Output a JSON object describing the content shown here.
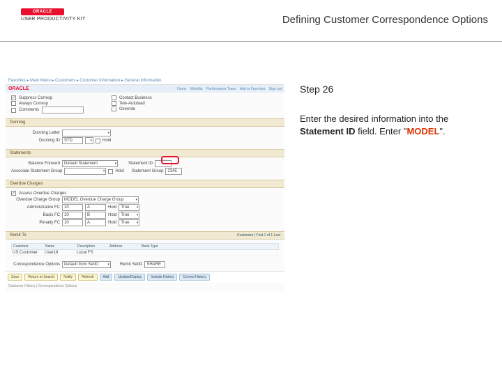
{
  "header": {
    "logo_text": "ORACLE",
    "upk_text": "USER PRODUCTIVITY KIT",
    "page_title": "Defining Customer Correspondence Options"
  },
  "screenshot": {
    "breadcrumbs": "Favorites ▸ Main Menu ▸ Customers ▸ Customer Information ▸ General Information",
    "brand": "ORACLE",
    "toplinks": [
      "Home",
      "Worklist",
      "Performance Trace",
      "Add to Favorites",
      "Sign out"
    ],
    "checks": {
      "suppress_corresp": "Suppress Corresp",
      "always_corresp": "Always Corresp",
      "comments": "Comments",
      "contact_business": "Contact Business",
      "tele_autoload": "Tele-Autoload",
      "override": "Override"
    },
    "dunning": {
      "heading": "Dunning",
      "dunning_letter_lbl": "Dunning Letter",
      "dunning_letter_val": "",
      "dunning_id_lbl": "Dunning ID",
      "dunning_id_val": "STD",
      "hold_lbl": "Hold"
    },
    "statements": {
      "heading": "Statements",
      "balance_frwd_lbl": "Balance Forward",
      "balance_frwd_val": "Default Statement",
      "statement_id_lbl": "Statement ID",
      "statement_id_val": "",
      "assoc_lbl": "Associate Statement Group",
      "assoc_val": "",
      "hold_lbl": "Hold",
      "statement_grp_lbl": "Statement Group",
      "statement_grp_val": "2345"
    },
    "overdue": {
      "heading": "Overdue Charges",
      "assess_lbl": "Assess Overdue Charges",
      "ovgrp_lbl": "Overdue Charge Group",
      "ovgrp_val": "MODEL Overdue Charge Group",
      "rows": [
        {
          "label": "Administrative FC",
          "v1": "10",
          "v2": "A",
          "v3": "Hold",
          "v4": "True"
        },
        {
          "label": "Basic FC",
          "v1": "10",
          "v2": "B",
          "v3": "Hold",
          "v4": "True"
        },
        {
          "label": "Penalty FC",
          "v1": "10",
          "v2": "A",
          "v3": "Hold",
          "v4": "True"
        }
      ]
    },
    "remitto": {
      "heading": "Remit To",
      "cols": [
        "Customer",
        "Name",
        "Description",
        "Address",
        "Bank Type"
      ],
      "row": [
        "US Customer",
        "User18",
        "Local FS",
        "",
        ""
      ]
    },
    "customize": "Customize | First 1 of 1 Last",
    "corrOptions": {
      "lbl": "Correspondence Options",
      "val": "Default from SetID",
      "sub_lbl": "Remit SetID",
      "sub_val": "SHARE"
    },
    "toolbar": {
      "save": "Save",
      "return": "Return to Search",
      "notify": "Notify",
      "refresh": "Refresh",
      "add": "Add",
      "update": "Update/Display",
      "include": "Include History",
      "correct": "Correct History"
    },
    "footer": "Customer History | Correspondence Options"
  },
  "right": {
    "step": "Step 26",
    "instr_prefix": "Enter the desired information into the ",
    "instr_bold": "Statement ID",
    "instr_mid": " field. Enter \"",
    "instr_model": "MODEL",
    "instr_suffix": "\"."
  }
}
